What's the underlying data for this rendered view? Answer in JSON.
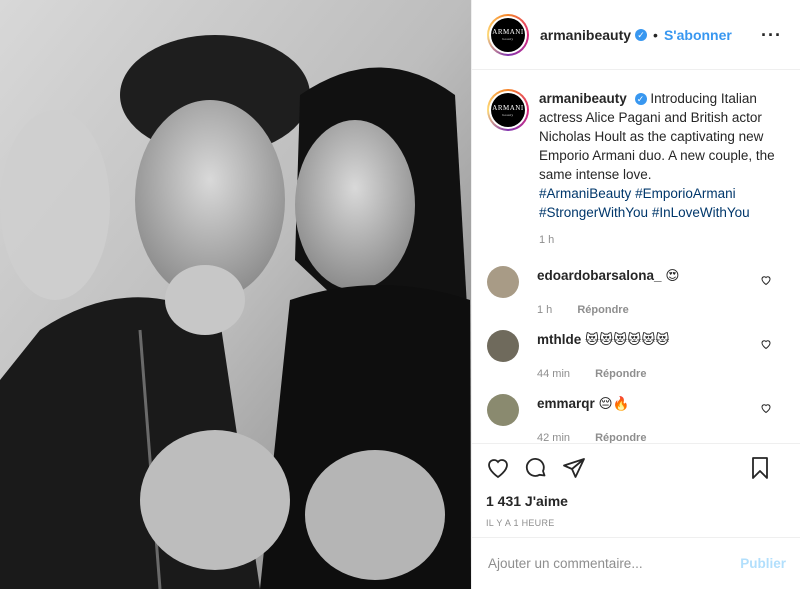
{
  "post": {
    "photo_alt": "Black and white photo of a couple",
    "account": {
      "username": "armanibeauty",
      "verified_mark": "✓",
      "logo_line1": "ARMANI",
      "logo_line2": "beauty",
      "separator": "•",
      "follow_label": "S'abonner",
      "more_label": "···"
    },
    "caption": {
      "username": "armanibeauty",
      "text": "Introducing Italian actress Alice Pagani and British actor Nicholas Hoult as the captivating new Emporio Armani duo. A new couple, the same intense love.",
      "hashtags": [
        "#ArmaniBeauty",
        "#EmporioArmani",
        "#StrongerWithYou",
        "#InLoveWithYou"
      ],
      "time": "1 h"
    },
    "comments": [
      {
        "username": "edoardobarsalona_",
        "text": "😍",
        "time": "1 h",
        "reply_label": "Répondre"
      },
      {
        "username": "mthlde",
        "text": "😻😻😻😻😻😻",
        "time": "44 min",
        "reply_label": "Répondre"
      },
      {
        "username": "emmarqr",
        "text": "😔🔥",
        "time": "42 min",
        "reply_label": "Répondre"
      }
    ],
    "likes": "1 431 J'aime",
    "posted_ago": "IL Y A 1 HEURE",
    "add_comment_placeholder": "Ajouter un commentaire...",
    "publish_label": "Publier"
  },
  "colors": {
    "link_blue": "#3897f0",
    "hashtag": "#00376b",
    "muted": "#8e8e8e"
  }
}
